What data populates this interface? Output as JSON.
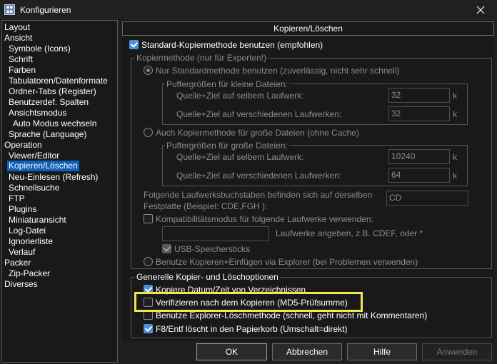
{
  "window": {
    "title": "Konfigurieren",
    "close_glyph": "✕"
  },
  "sidebar": {
    "items": [
      {
        "label": "Layout"
      },
      {
        "label": "Ansicht"
      },
      {
        "label": "Symbole (Icons)"
      },
      {
        "label": "Schrift"
      },
      {
        "label": "Farben"
      },
      {
        "label": "Tabulatoren/Datenformate"
      },
      {
        "label": "Ordner-Tabs (Register)"
      },
      {
        "label": "Benutzerdef. Spalten"
      },
      {
        "label": "Ansichtsmodus"
      },
      {
        "label": "Auto Modus wechseln"
      },
      {
        "label": "Sprache (Language)"
      },
      {
        "label": "Operation"
      },
      {
        "label": "Viewer/Editor"
      },
      {
        "label": "Kopieren/Löschen",
        "selected": true
      },
      {
        "label": "Neu-Einlesen (Refresh)"
      },
      {
        "label": "Schnellsuche"
      },
      {
        "label": "FTP"
      },
      {
        "label": "Plugins"
      },
      {
        "label": "Miniaturansicht"
      },
      {
        "label": "Log-Datei"
      },
      {
        "label": "Ignorierliste"
      },
      {
        "label": "Verlauf"
      },
      {
        "label": "Packer"
      },
      {
        "label": "Zip-Packer"
      },
      {
        "label": "Diverses"
      }
    ]
  },
  "page": {
    "header": "Kopieren/Löschen",
    "standard_method": {
      "label": "Standard-Kopiermethode benutzen (empfohlen)",
      "checked": true
    },
    "method_group": {
      "title": "Kopiermethode (nur für Experten!)",
      "only_standard": {
        "label": "Nur Standardmethode benutzen (zuverlässig, nicht sehr schnell)",
        "selected": true
      },
      "small_files": {
        "title": "Puffergrößen für kleine Dateien:",
        "same_drive_label": "Quelle+Ziel auf selbem Laufwerk:",
        "same_drive_value": "32",
        "diff_drive_label": "Quelle+Ziel auf verschiedenen Laufwerken:",
        "diff_drive_value": "32",
        "unit": "k"
      },
      "large_method": {
        "label": "Auch Kopiermethode für große Dateien (ohne Cache)",
        "selected": false
      },
      "large_files": {
        "title": "Puffergrößen für große Dateien:",
        "same_drive_label": "Quelle+Ziel auf selbem Laufwerk:",
        "same_drive_value": "10240",
        "diff_drive_label": "Quelle+Ziel auf verschiedenen Laufwerken:",
        "diff_drive_value": "64",
        "unit": "k"
      },
      "drive_letters_line1": "Folgende Laufwerksbuchstaben befinden sich auf derselben",
      "drive_letters_line2": "Festplatte (Beispiel: CDE,FGH ):",
      "drive_letters_value": "CD",
      "compat_mode": {
        "label": "Kompatibilitätsmodus für folgende Laufwerke verwenden:",
        "checked": false
      },
      "compat_input_value": "",
      "compat_hint": "Laufwerke angeben, z.B. CDEF, oder *",
      "usb": {
        "label": "USB-Speichersticks",
        "checked": true
      },
      "explorer_paste": {
        "label": "Benutze Kopieren+Einfügen via Explorer (bei Problemen verwenden)",
        "selected": false
      }
    },
    "general_group": {
      "title": "Generelle Kopier- und Löschoptionen",
      "options": [
        {
          "label": "Kopiere Datum/Zeit von Verzeichnissen",
          "checked": true
        },
        {
          "label": "Verifizieren nach dem Kopieren (MD5-Prüfsumme)",
          "checked": false
        },
        {
          "label": "Benutze Explorer-Löschmethode (schnell, geht nicht mit Kommentaren)",
          "checked": false
        },
        {
          "label": "F8/Entf löscht in den Papierkorb (Umschalt=direkt)",
          "checked": true
        }
      ]
    }
  },
  "buttons": {
    "ok": "OK",
    "cancel": "Abbrechen",
    "help": "Hilfe",
    "apply": "Anwenden"
  },
  "colors": {
    "accent": "#0f5fb8",
    "checkbox": "#4d8fdb",
    "highlight": "#f2e64a"
  }
}
